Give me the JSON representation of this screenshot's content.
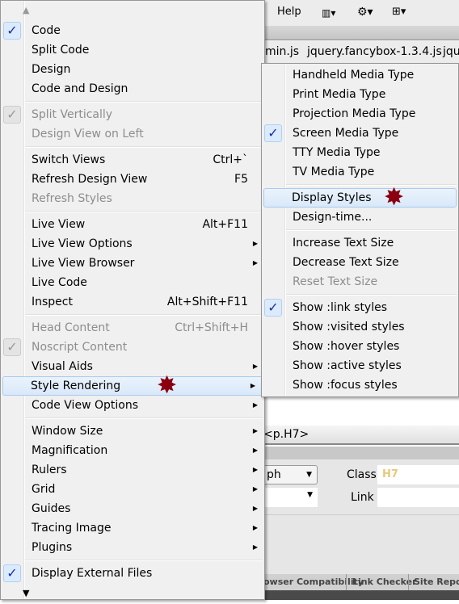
{
  "toolbar": {
    "help": "Help",
    "icons": [
      "layout-icon",
      "gear-icon",
      "site-icon"
    ]
  },
  "doc_tabs": [
    "min.js",
    "jquery.fancybox-1.3.4.js",
    "jqu"
  ],
  "tag_selector": "<p.H7>",
  "properties": {
    "format_value": "ph",
    "class_label": "Class",
    "class_value": "H7",
    "link_label": "Link",
    "class_color": "#e8c97a"
  },
  "bottom_tabs": [
    "owser Compatibility",
    "Link Checker",
    "Site Reports"
  ],
  "main_menu": [
    {
      "label": "Code",
      "checked": true
    },
    {
      "label": "Split Code"
    },
    {
      "label": "Design"
    },
    {
      "label": "Code and Design"
    },
    {
      "sep": true
    },
    {
      "label": "Split Vertically",
      "checked": true,
      "disabled": true
    },
    {
      "label": "Design View on Left",
      "disabled": true
    },
    {
      "sep": true
    },
    {
      "label": "Switch Views",
      "shortcut": "Ctrl+`"
    },
    {
      "label": "Refresh Design View",
      "shortcut": "F5"
    },
    {
      "label": "Refresh Styles",
      "disabled": true
    },
    {
      "sep": true
    },
    {
      "label": "Live View",
      "shortcut": "Alt+F11"
    },
    {
      "label": "Live View Options",
      "submenu": true
    },
    {
      "label": "Live View Browser",
      "submenu": true
    },
    {
      "label": "Live Code"
    },
    {
      "label": "Inspect",
      "shortcut": "Alt+Shift+F11"
    },
    {
      "sep": true
    },
    {
      "label": "Head Content",
      "shortcut": "Ctrl+Shift+H",
      "disabled": true
    },
    {
      "label": "Noscript Content",
      "checked": true,
      "disabled": true
    },
    {
      "label": "Visual Aids",
      "submenu": true
    },
    {
      "label": "Style Rendering",
      "submenu": true,
      "highlighted": true,
      "marked": true
    },
    {
      "label": "Code View Options",
      "submenu": true
    },
    {
      "sep": true
    },
    {
      "label": "Window Size",
      "submenu": true
    },
    {
      "label": "Magnification",
      "submenu": true
    },
    {
      "label": "Rulers",
      "submenu": true
    },
    {
      "label": "Grid",
      "submenu": true
    },
    {
      "label": "Guides",
      "submenu": true
    },
    {
      "label": "Tracing Image",
      "submenu": true
    },
    {
      "label": "Plugins",
      "submenu": true
    },
    {
      "sep": true
    },
    {
      "label": "Display External Files",
      "checked": true
    }
  ],
  "sub_menu": [
    {
      "label": "Handheld Media Type"
    },
    {
      "label": "Print Media Type"
    },
    {
      "label": "Projection Media Type"
    },
    {
      "label": "Screen Media Type",
      "checked": true
    },
    {
      "label": "TTY Media Type"
    },
    {
      "label": "TV Media Type"
    },
    {
      "sep": true
    },
    {
      "label": "Display Styles",
      "highlighted": true,
      "marked": true
    },
    {
      "label": "Design-time..."
    },
    {
      "sep": true
    },
    {
      "label": "Increase Text Size"
    },
    {
      "label": "Decrease Text Size"
    },
    {
      "label": "Reset Text Size",
      "disabled": true
    },
    {
      "sep": true
    },
    {
      "label": "Show :link styles",
      "checked": true
    },
    {
      "label": "Show :visited styles"
    },
    {
      "label": "Show :hover styles"
    },
    {
      "label": "Show :active styles"
    },
    {
      "label": "Show :focus styles"
    }
  ]
}
